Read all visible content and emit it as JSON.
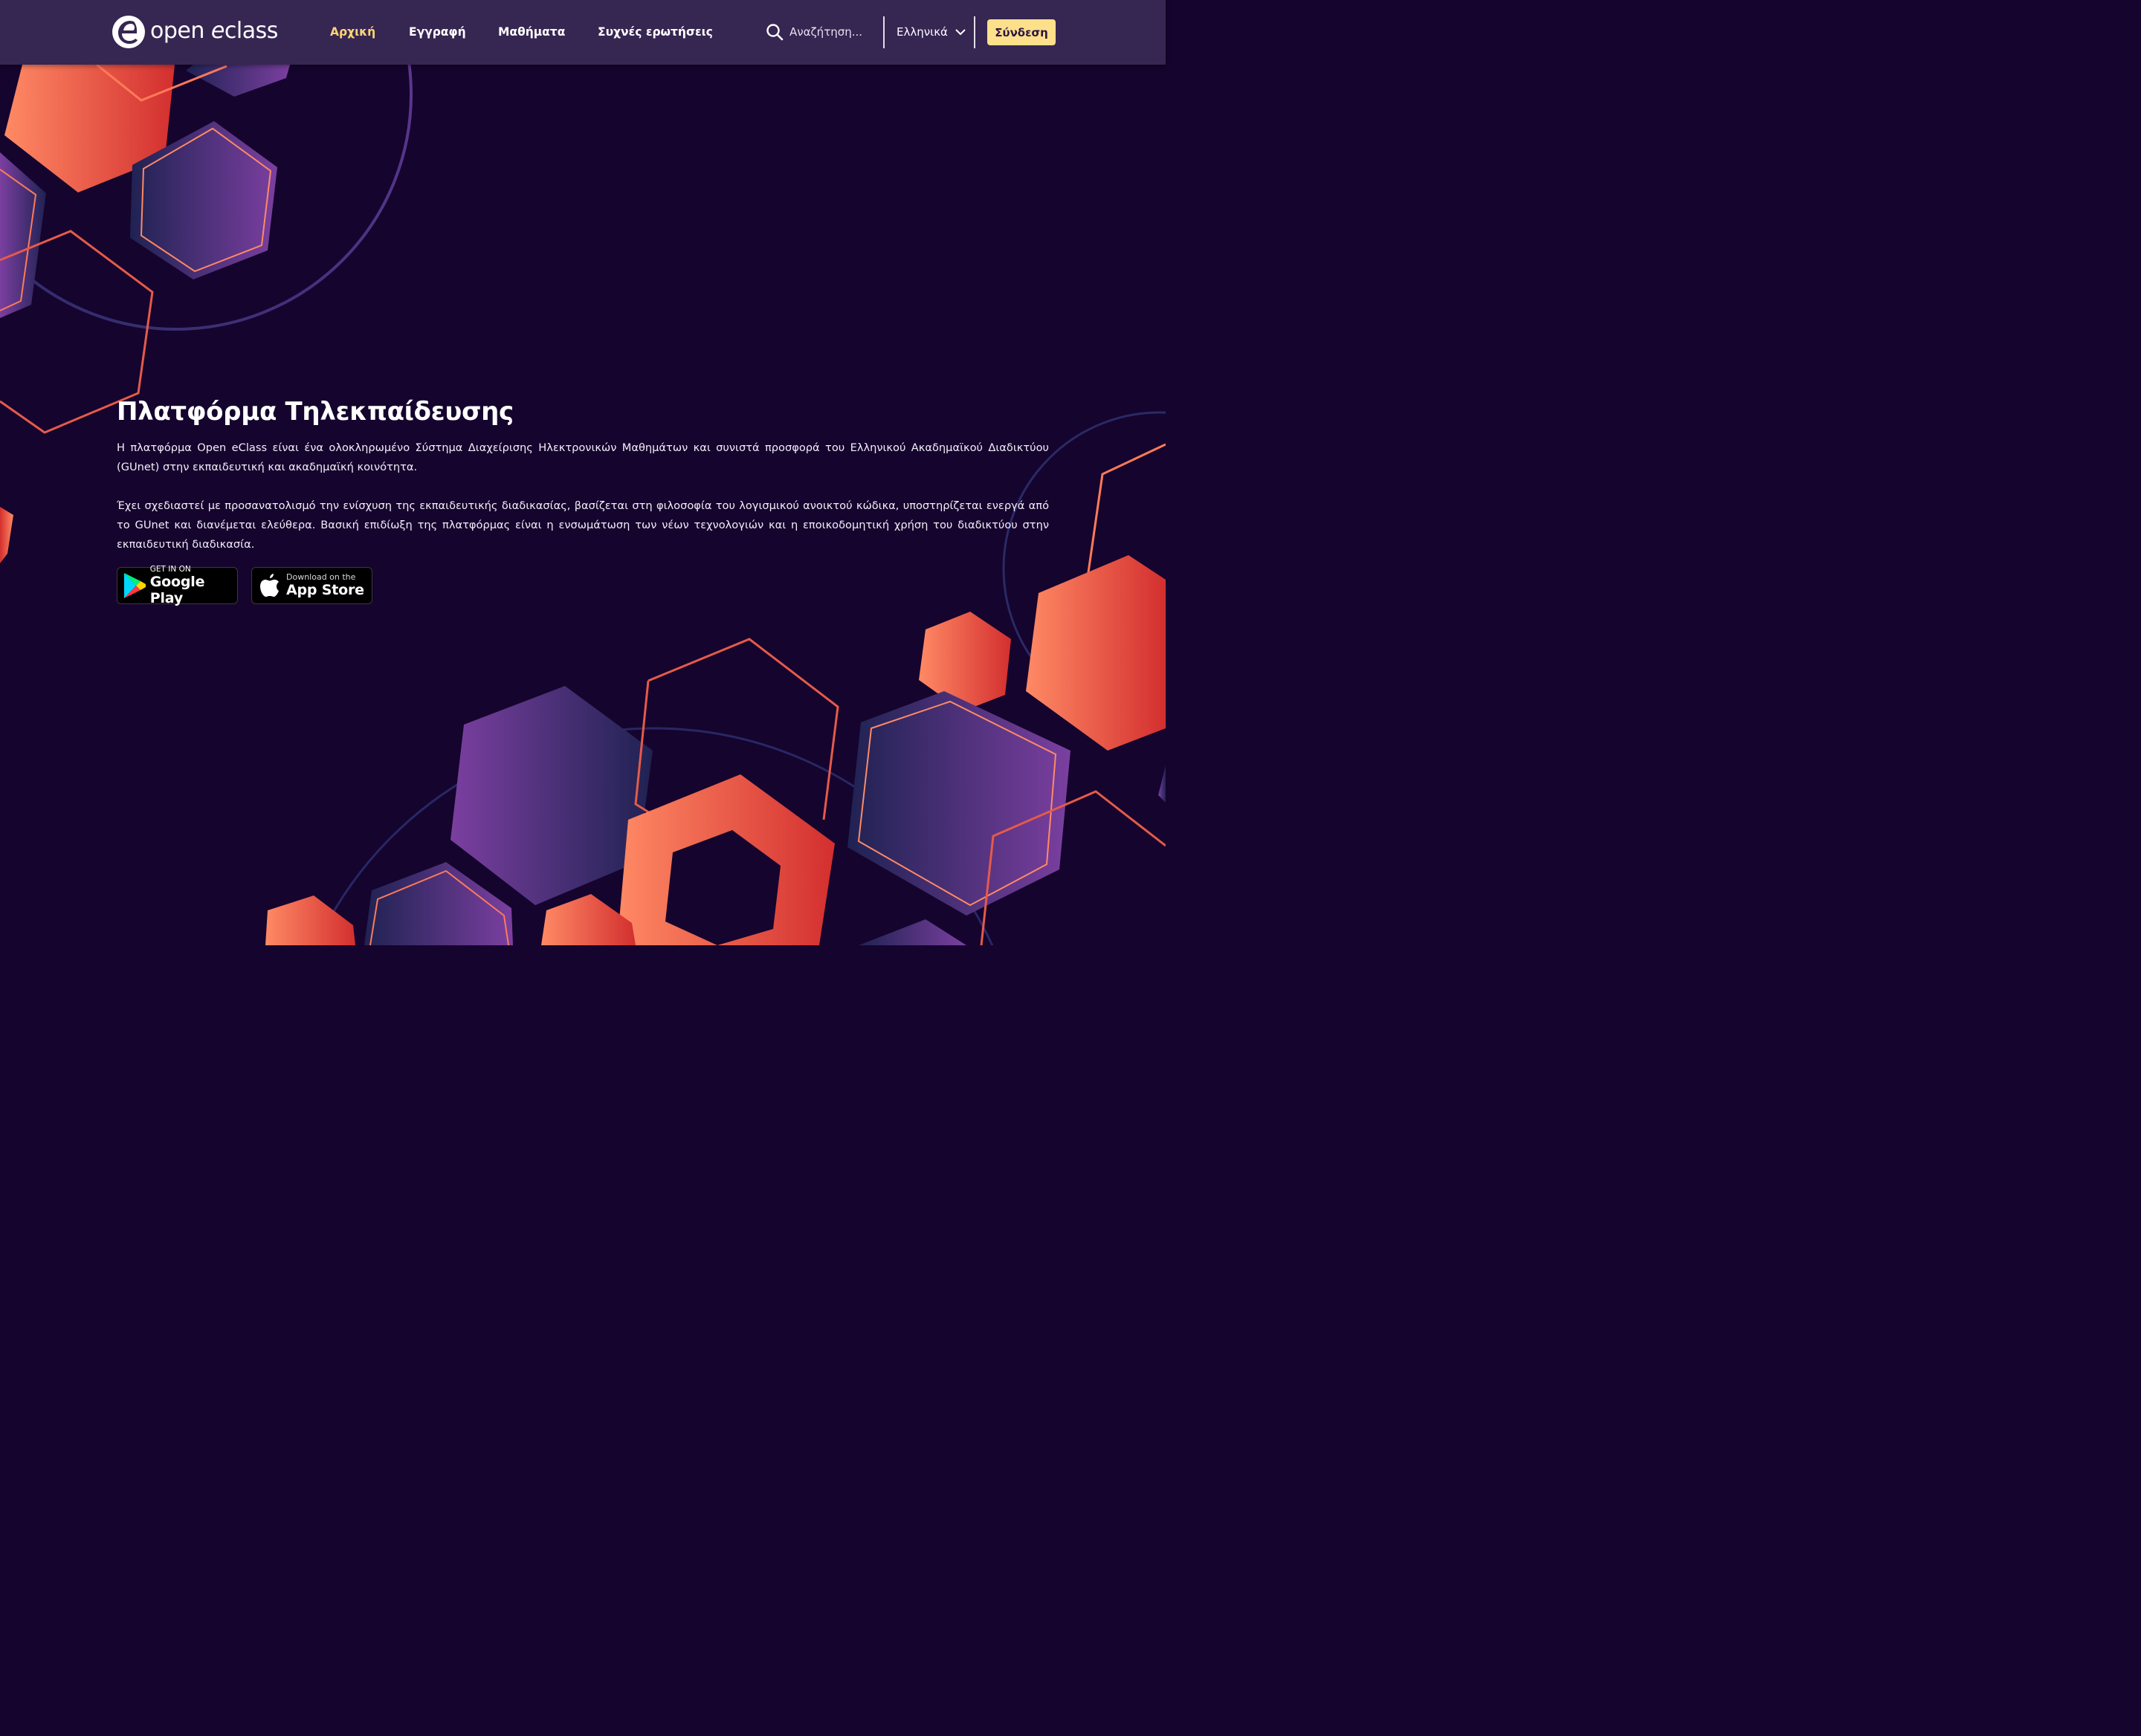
{
  "brand": {
    "logo_text_main": "open ",
    "logo_text_e": "e",
    "logo_text_tail": "class"
  },
  "nav": [
    {
      "label": "Αρχική",
      "active": true
    },
    {
      "label": "Εγγραφή",
      "active": false
    },
    {
      "label": "Μαθήματα",
      "active": false
    },
    {
      "label": "Συχνές ερωτήσεις",
      "active": false
    }
  ],
  "search": {
    "placeholder": "Αναζήτηση...",
    "value": ""
  },
  "language": {
    "selected": "Ελληνικά"
  },
  "login_label": "Σύνδεση",
  "hero": {
    "title": "Πλατφόρμα Τηλεκπαίδευσης",
    "paragraph1": "Η πλατφόρμα Open eClass είναι ένα ολοκληρωμένο Σύστημα Διαχείρισης Ηλεκτρονικών Μαθημάτων και συνιστά προσφορά του Ελληνικού Ακαδημαϊκού Διαδικτύου (GUnet) στην εκπαιδευτική και ακαδημαϊκή κοινότητα.",
    "paragraph2": "Έχει σχεδιαστεί με προσανατολισμό την ενίσχυση της εκπαιδευτικής διαδικασίας, βασίζεται στη φιλοσοφία του λογισμικού ανοικτού κώδικα, υποστηρίζεται ενεργά από το GUnet και διανέμεται ελεύθερα. Βασική επιδίωξη της πλατφόρμας είναι η ενσωμάτωση των νέων τεχνολογιών και η εποικοδομητική χρήση του διαδικτύου στην εκπαιδευτική διαδικασία."
  },
  "stores": {
    "google": {
      "small": "GET IN ON",
      "big": "Google Play",
      "icon": "google-play-icon"
    },
    "apple": {
      "small": "Download on the",
      "big": "App Store",
      "icon": "apple-icon"
    }
  },
  "colors": {
    "header_bg": "#362652",
    "page_bg": "#15042d",
    "nav_active": "#ffd475",
    "login_bg": "#ffe08a",
    "accent_orange": "#ff8a65",
    "accent_red": "#d32f2f",
    "accent_purple": "#7b3fa0"
  }
}
